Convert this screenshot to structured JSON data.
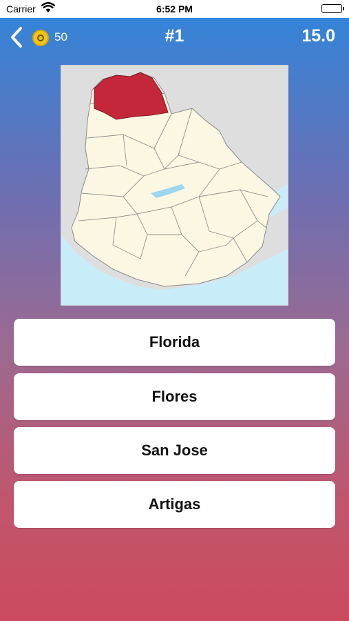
{
  "status_bar": {
    "carrier": "Carrier",
    "time": "6:52 PM"
  },
  "header": {
    "coins": "50",
    "question_number": "#1",
    "timer": "15.0"
  },
  "map": {
    "highlight_color": "#c4273a",
    "land_color": "#fbf7e2",
    "water_color": "#c9ecf9",
    "outside_color": "#dedede"
  },
  "answers": [
    {
      "label": "Florida"
    },
    {
      "label": "Flores"
    },
    {
      "label": "San Jose"
    },
    {
      "label": "Artigas"
    }
  ]
}
